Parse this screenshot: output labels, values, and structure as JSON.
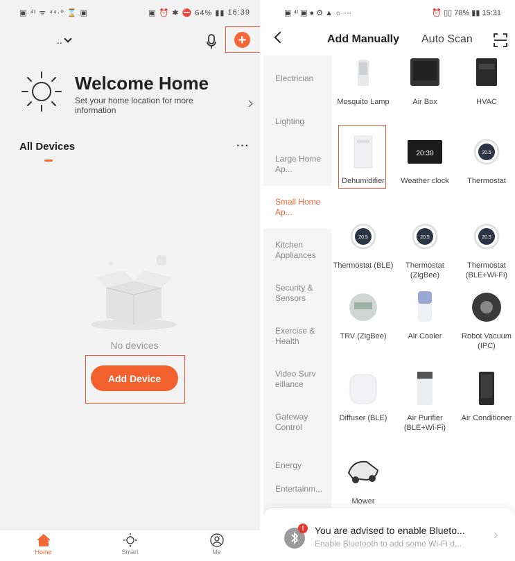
{
  "left": {
    "status": {
      "icons": "▣ ⁴ᴵ ᯤ ⁴⁴·⁰ ⌛ ▣",
      "right_icons": "▣ ⏰ ✱ ⛔ 64% ▮▮ ",
      "time": "16:39"
    },
    "home_selector": "..",
    "welcome": {
      "title": "Welcome Home",
      "subtitle": "Set your home location for more information"
    },
    "devices_header": "All Devices",
    "more": "···",
    "empty_text": "No devices",
    "add_device": "Add Device",
    "nav": [
      {
        "label": "Home",
        "icon": "home-icon"
      },
      {
        "label": "Smart",
        "icon": "sun-icon"
      },
      {
        "label": "Me",
        "icon": "user-icon"
      }
    ]
  },
  "right": {
    "status": {
      "icons": "▣ ⁴ᴵ ▣ ● ⚙ ▲ ☼ ···",
      "right_icons": "⏰ ▯▯ 78% ▮▮ ",
      "time": "15:31"
    },
    "tab_manual": "Add Manually",
    "tab_scan": "Auto Scan",
    "categories": [
      "Electrician",
      "Lighting",
      "Large Home Ap...",
      "Small Home Ap...",
      "Kitchen Appliances",
      "Security & Sensors",
      "Exercise & Health",
      "Video Surv eillance",
      "Gateway Control",
      "Energy",
      "Entertainm..."
    ],
    "active_category": "Small Home Ap...",
    "devices": [
      {
        "name": "Mosquito Lamp",
        "icon": "mosquito-lamp"
      },
      {
        "name": "Air Box",
        "icon": "air-box"
      },
      {
        "name": "HVAC",
        "icon": "hvac"
      },
      {
        "name": "Dehumidifier",
        "icon": "dehumidifier"
      },
      {
        "name": "Weather clock",
        "icon": "weather-clock",
        "screen_text": "20:30"
      },
      {
        "name": "Thermostat",
        "icon": "thermostat",
        "screen_text": "20.5"
      },
      {
        "name": "Thermostat (BLE)",
        "icon": "thermostat",
        "screen_text": "20.5"
      },
      {
        "name": "Thermostat (ZigBee)",
        "icon": "thermostat",
        "screen_text": "20.5"
      },
      {
        "name": "Thermostat (BLE+Wi-Fi)",
        "icon": "thermostat",
        "screen_text": "20.5"
      },
      {
        "name": "TRV (ZigBee)",
        "icon": "trv"
      },
      {
        "name": "Air Cooler",
        "icon": "air-cooler"
      },
      {
        "name": "Robot Vacuum (IPC)",
        "icon": "robot-vacuum"
      },
      {
        "name": "Diffuser (BLE)",
        "icon": "diffuser"
      },
      {
        "name": "Air Purifier (BLE+Wi-Fi)",
        "icon": "air-purifier"
      },
      {
        "name": "Air Conditioner",
        "icon": "air-conditioner"
      },
      {
        "name": "Mower",
        "icon": "mower"
      }
    ],
    "banner": {
      "title": "You are advised to enable Blueto...",
      "subtitle": "Enable Bluetooth to add some Wi-Fi d...",
      "badge": "!"
    }
  },
  "colors": {
    "accent": "#f26836",
    "highlight": "#e65a36",
    "text": "#222222",
    "muted": "#888888"
  }
}
